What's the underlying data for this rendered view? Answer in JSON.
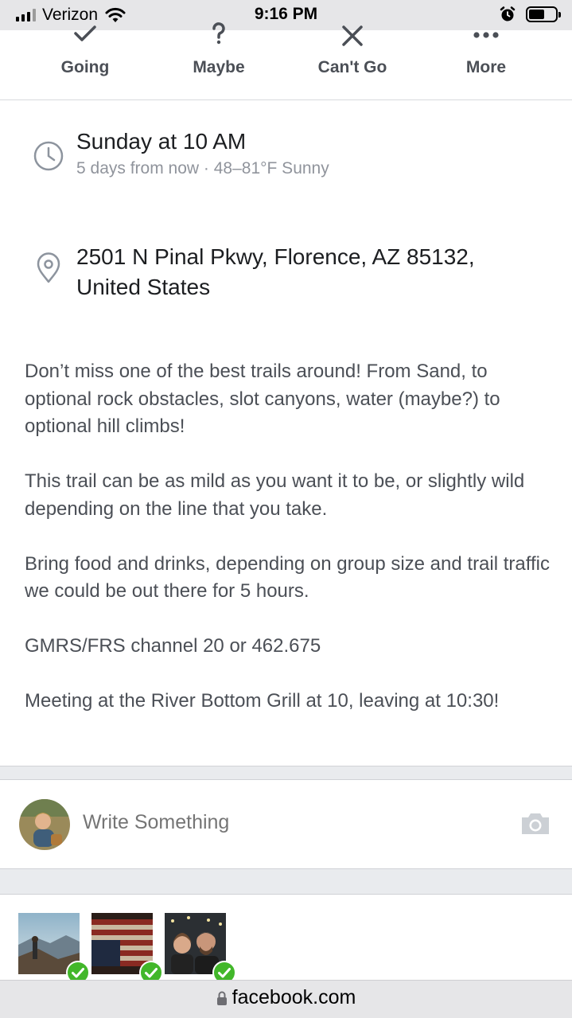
{
  "status_bar": {
    "carrier": "Verizon",
    "time": "9:16 PM",
    "icons": [
      "signal-icon",
      "wifi-icon",
      "alarm-icon",
      "battery-icon"
    ],
    "battery_level": 0.6
  },
  "rsvp": {
    "going": {
      "label": "Going",
      "icon": "check-icon"
    },
    "maybe": {
      "label": "Maybe",
      "icon": "question-icon"
    },
    "cant_go": {
      "label": "Can't Go",
      "icon": "x-icon"
    },
    "more": {
      "label": "More",
      "icon": "ellipsis-icon"
    }
  },
  "event": {
    "time_title": "Sunday at 10 AM",
    "time_subtitle": "5 days from now · 48–81°F Sunny",
    "location_line1": "2501 N Pinal Pkwy, Florence, AZ 85132,",
    "location_line2": "United States",
    "description": [
      "Don’t miss one of the best trails around! From Sand, to optional rock obstacles, slot canyons, water (maybe?) to optional hill climbs!",
      "This trail can be as mild as you want it to be, or slightly wild depending on the line that you take.",
      "Bring food and drinks, depending on group size and trail traffic we could be out there for 5 hours.",
      "GMRS/FRS channel 20 or 462.675",
      "Meeting at the River Bottom Grill at 10, leaving at 10:30!"
    ]
  },
  "composer": {
    "placeholder": "Write Something",
    "camera_icon": "camera-icon"
  },
  "photos": [
    {
      "subject": "person-on-mountain-photo",
      "checked": true
    },
    {
      "subject": "american-flag-photo",
      "checked": true
    },
    {
      "subject": "couple-selfie-photo",
      "checked": true
    }
  ],
  "url_bar": {
    "domain": "facebook.com",
    "icon": "lock-icon"
  },
  "colors": {
    "status_bar_bg": "#e6e6e8",
    "secondary_text": "#90949c",
    "body_text": "#4b4f56",
    "check_green": "#42b72a",
    "separator": "#e9ebee"
  }
}
